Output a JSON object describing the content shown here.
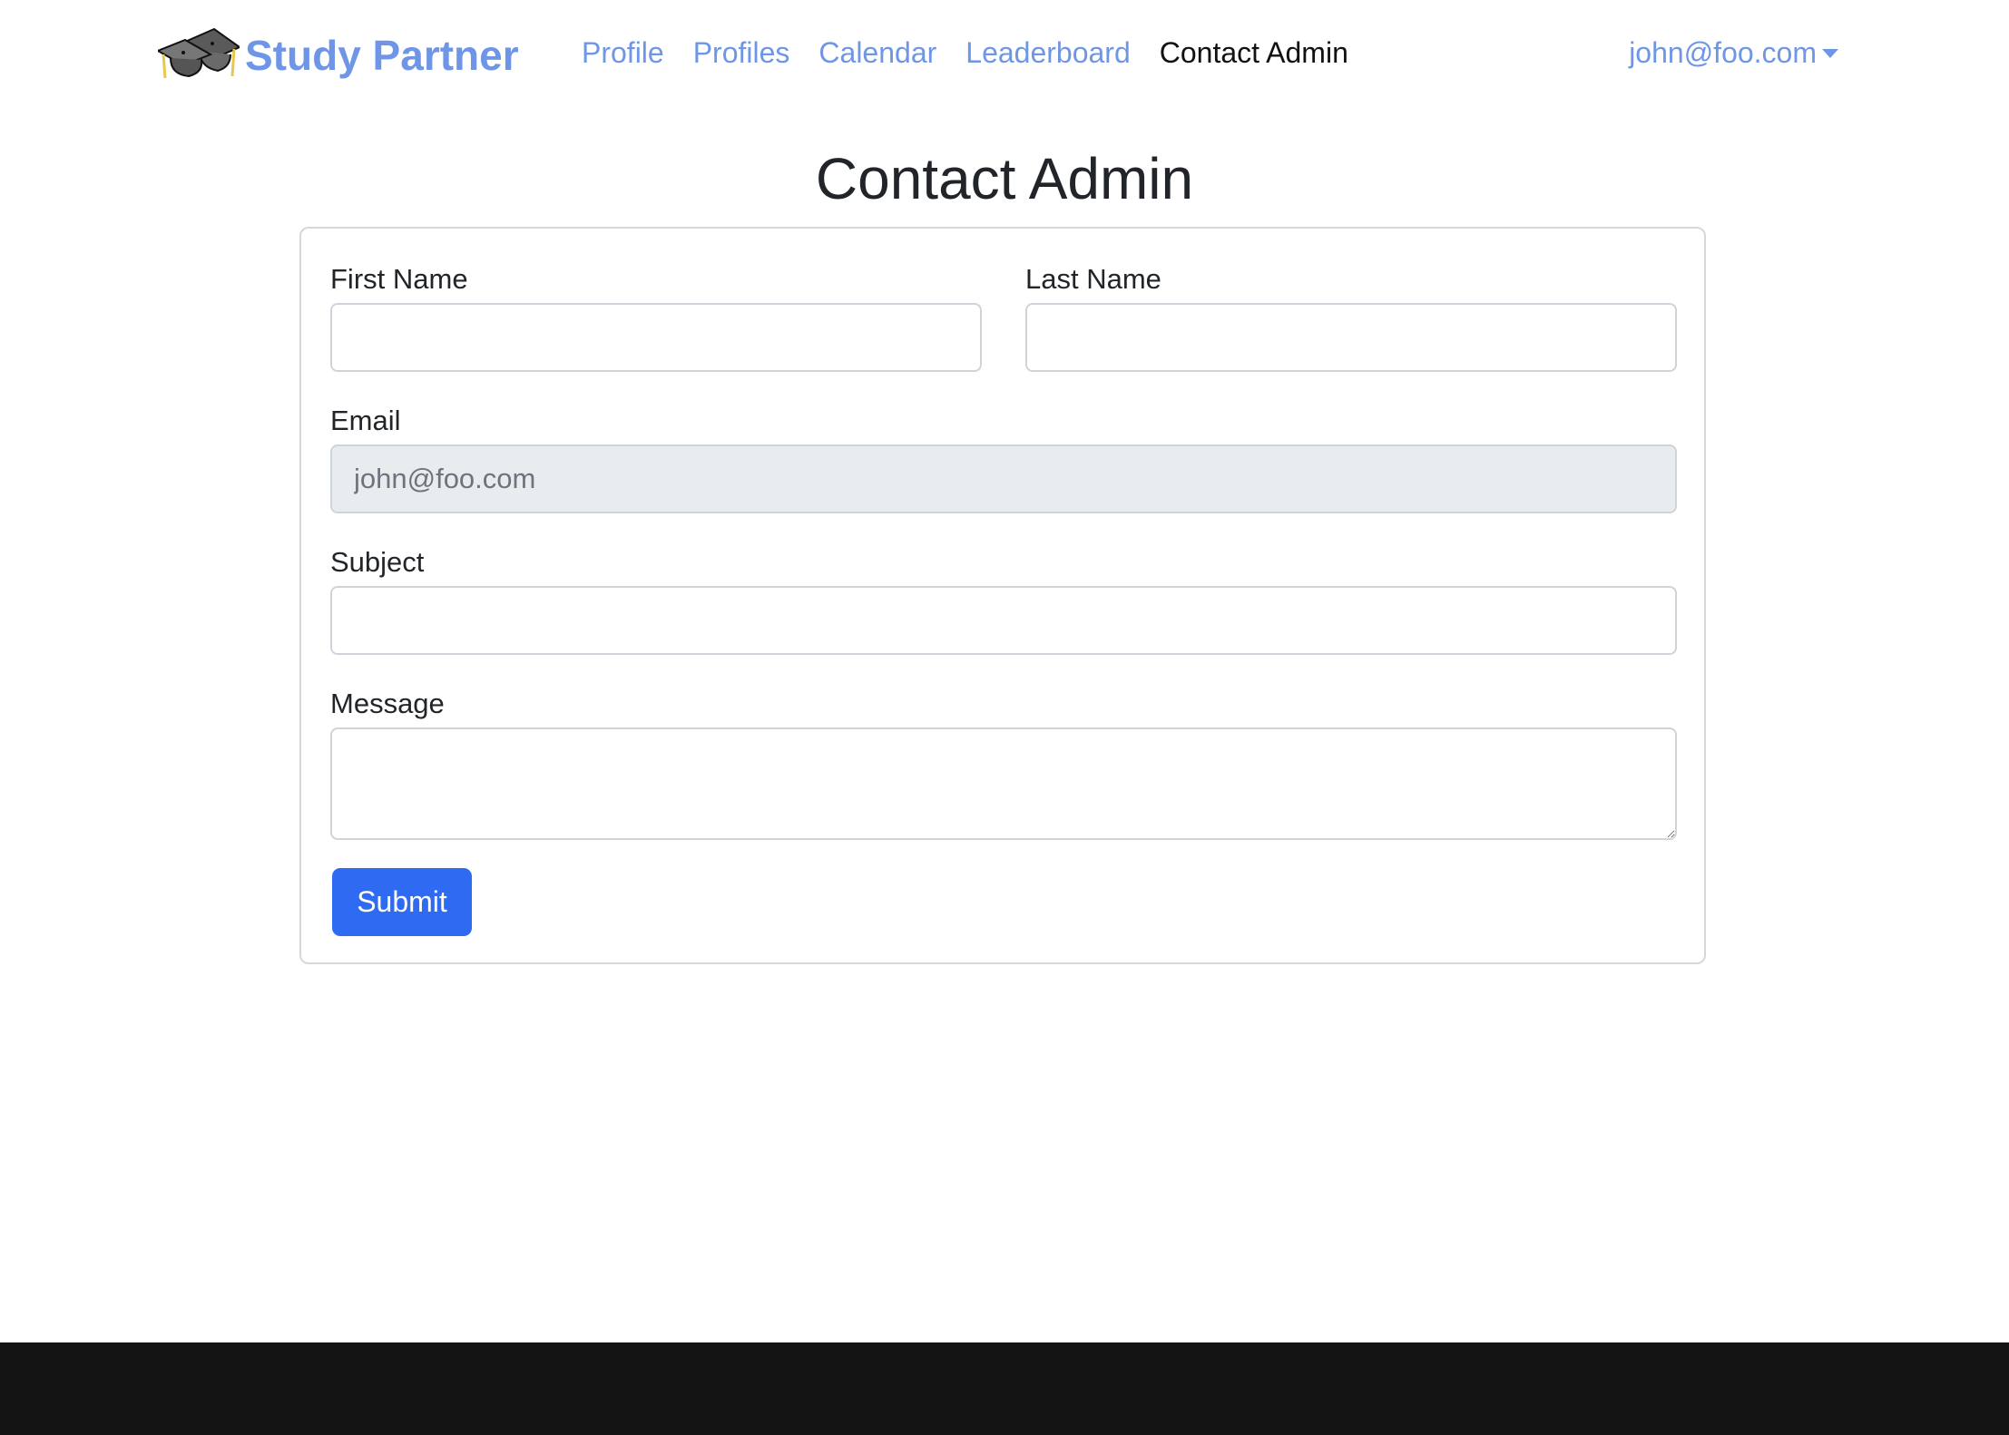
{
  "navbar": {
    "brand": "Study Partner",
    "links": [
      {
        "label": "Profile"
      },
      {
        "label": "Profiles"
      },
      {
        "label": "Calendar"
      },
      {
        "label": "Leaderboard"
      },
      {
        "label": "Contact Admin",
        "active": true
      }
    ],
    "user_email": "john@foo.com"
  },
  "page": {
    "title": "Contact Admin"
  },
  "form": {
    "first_name": {
      "label": "First Name",
      "value": ""
    },
    "last_name": {
      "label": "Last Name",
      "value": ""
    },
    "email": {
      "label": "Email",
      "value": "john@foo.com",
      "disabled": true
    },
    "subject": {
      "label": "Subject",
      "value": ""
    },
    "message": {
      "label": "Message",
      "value": ""
    },
    "submit_label": "Submit"
  },
  "colors": {
    "accent": "#6f96e6",
    "primary_button": "#2f6bf2",
    "footer": "#141414"
  }
}
